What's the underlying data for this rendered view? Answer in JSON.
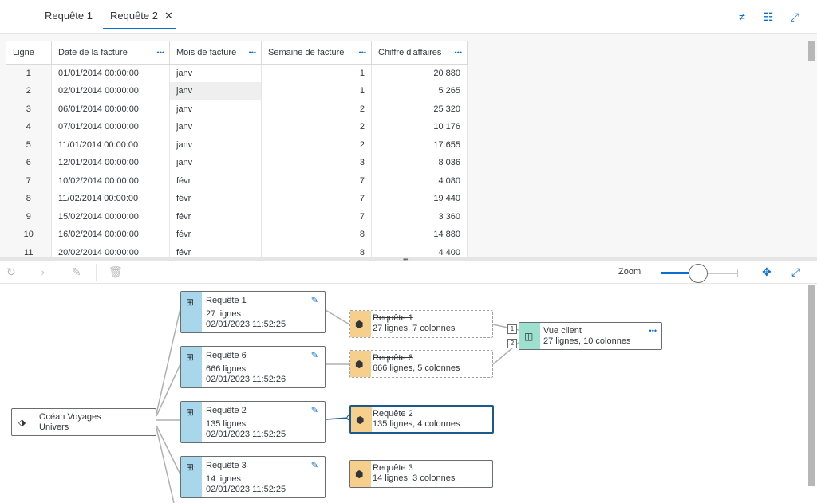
{
  "tabs": [
    {
      "label": "Requête 1",
      "active": false
    },
    {
      "label": "Requête 2",
      "active": true
    }
  ],
  "top_icons": [
    "not-equal-icon",
    "column-list-icon",
    "fullscreen-icon"
  ],
  "table": {
    "columns": [
      "Ligne",
      "Date de la facture",
      "Mois de facture",
      "Semaine de facture",
      "Chiffre d'affaires"
    ],
    "rows": [
      [
        "1",
        "01/01/2014 00:00:00",
        "janv",
        "1",
        "20 880"
      ],
      [
        "2",
        "02/01/2014 00:00:00",
        "janv",
        "1",
        "5 265"
      ],
      [
        "3",
        "06/01/2014 00:00:00",
        "janv",
        "2",
        "25 320"
      ],
      [
        "4",
        "07/01/2014 00:00:00",
        "janv",
        "2",
        "10 176"
      ],
      [
        "5",
        "11/01/2014 00:00:00",
        "janv",
        "2",
        "17 655"
      ],
      [
        "6",
        "12/01/2014 00:00:00",
        "janv",
        "3",
        "8 036"
      ],
      [
        "7",
        "10/02/2014 00:00:00",
        "févr",
        "7",
        "4 080"
      ],
      [
        "8",
        "11/02/2014 00:00:00",
        "févr",
        "7",
        "19 440"
      ],
      [
        "9",
        "15/02/2014 00:00:00",
        "févr",
        "7",
        "3 360"
      ],
      [
        "10",
        "16/02/2014 00:00:00",
        "févr",
        "8",
        "14 880"
      ],
      [
        "11",
        "20/02/2014 00:00:00",
        "févr",
        "8",
        "4 400"
      ]
    ]
  },
  "toolbar": {
    "zoom_label": "Zoom",
    "zoom_level": 0.5
  },
  "diagram": {
    "source": {
      "line1": "Océan Voyages",
      "line2": "Univers"
    },
    "queries": [
      {
        "title": "Requête 1",
        "rows": "27 lignes",
        "date": "02/01/2023 11:52:25"
      },
      {
        "title": "Requête 6",
        "rows": "666 lignes",
        "date": "02/01/2023 11:52:26"
      },
      {
        "title": "Requête 2",
        "rows": "135 lignes",
        "date": "02/01/2023 11:52:25"
      },
      {
        "title": "Requête 3",
        "rows": "14 lignes",
        "date": "02/01/2023 11:52:25"
      }
    ],
    "datasets": [
      {
        "title": "Requête 1",
        "info": "27 lignes, 7 colonnes"
      },
      {
        "title": "Requête 6",
        "info": "666 lignes, 5 colonnes"
      },
      {
        "title": "Requête 2",
        "info": "135 lignes, 4 colonnes"
      },
      {
        "title": "Requête 3",
        "info": "14 lignes, 3 colonnes"
      }
    ],
    "view": {
      "title": "Vue client",
      "info": "27 lignes, 10 colonnes",
      "badges": [
        "1",
        "2"
      ]
    },
    "colors": {
      "query_side": "#a8d6eb",
      "dataset_side": "#f7cf8c",
      "view_side": "#9ee0cf",
      "selected_border": "#0a6ed1"
    }
  }
}
